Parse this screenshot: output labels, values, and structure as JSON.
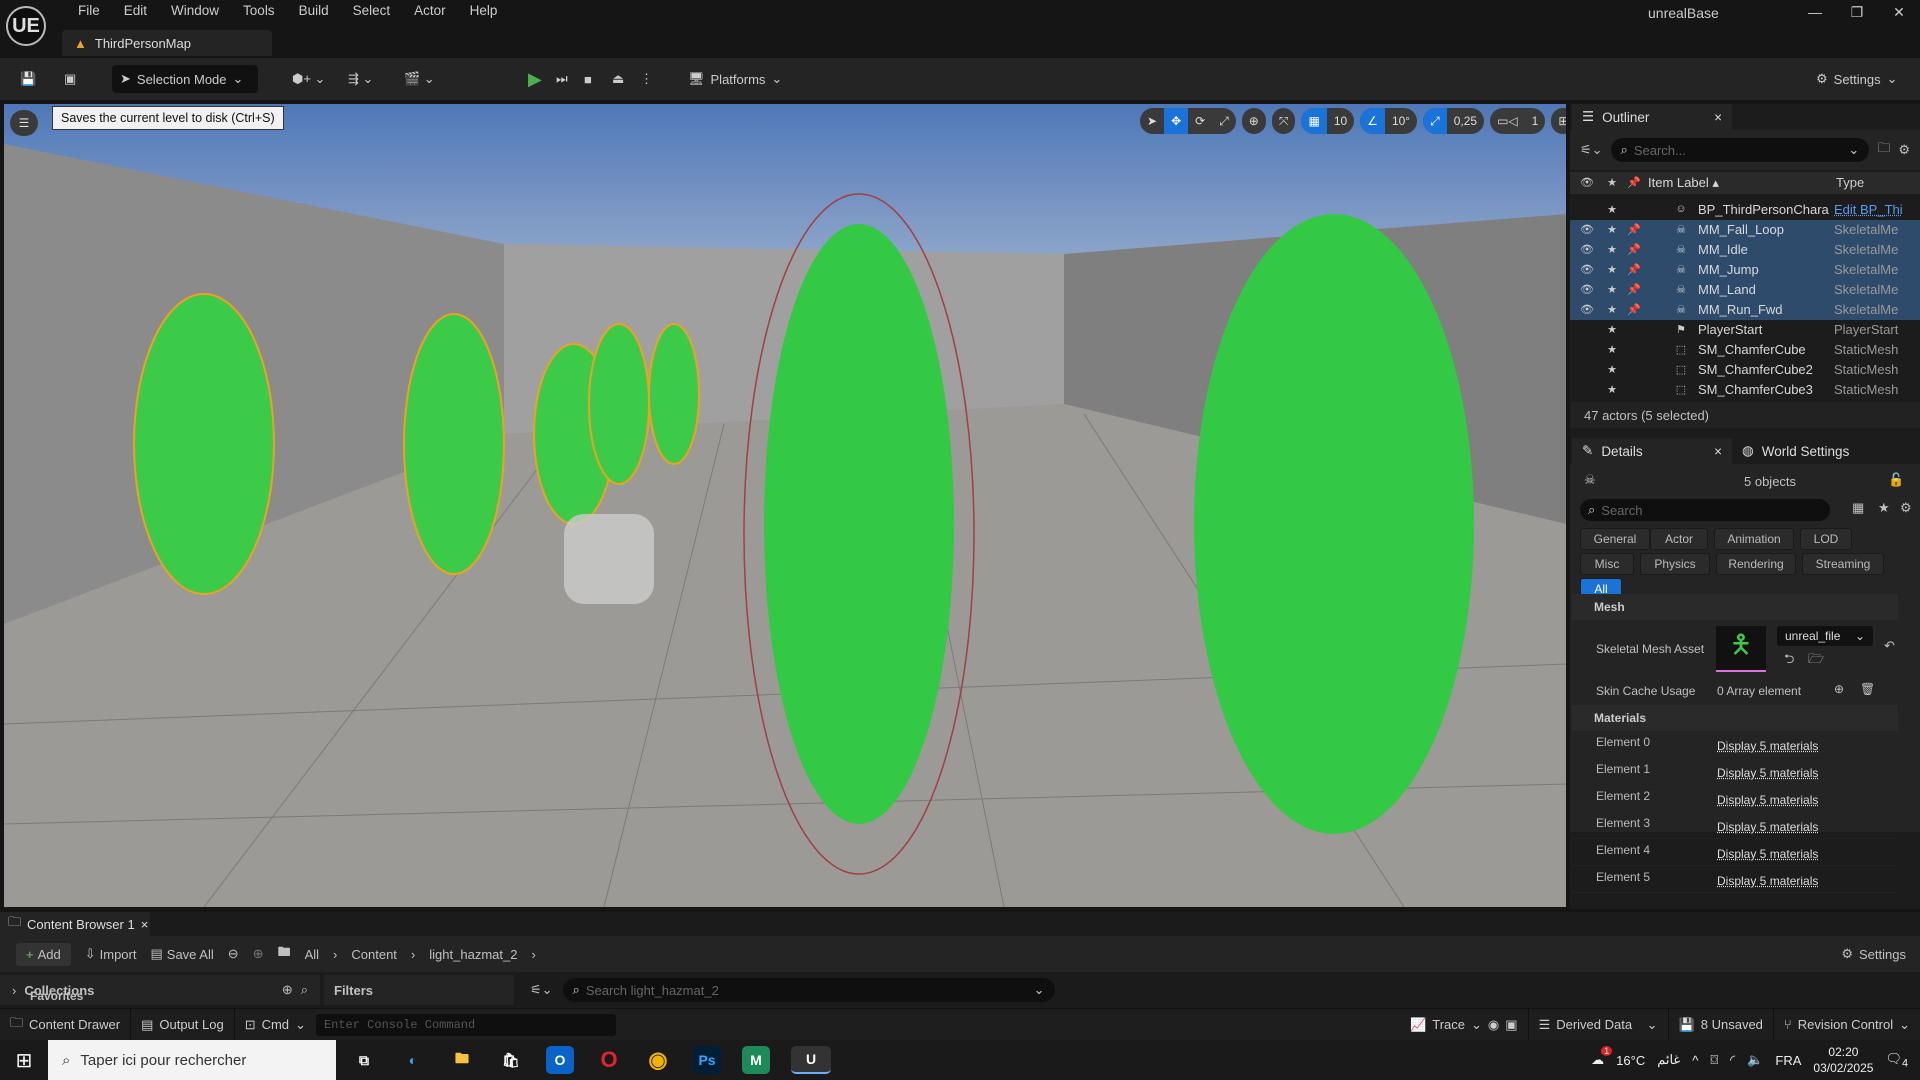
{
  "app": {
    "title": "unrealBase",
    "logo": "UE",
    "map_tab": "ThirdPersonMap"
  },
  "menu": [
    "File",
    "Edit",
    "Window",
    "Tools",
    "Build",
    "Select",
    "Actor",
    "Help"
  ],
  "toolbar": {
    "selection_mode": "Selection Mode",
    "platforms": "Platforms",
    "settings": "Settings",
    "tooltip": "Saves the current level to disk (Ctrl+S)"
  },
  "viewport": {
    "grid_snap": "10",
    "angle_snap": "10°",
    "scale_snap": "0,25",
    "camera_speed": "1"
  },
  "outliner": {
    "title": "Outliner",
    "search_placeholder": "Search...",
    "col_label": "Item Label",
    "col_type": "Type",
    "rows": [
      {
        "label": "BP_ThirdPersonChara",
        "type": "Edit BP_Thi",
        "selected": false,
        "icon": "character-icon"
      },
      {
        "label": "MM_Fall_Loop",
        "type": "SkeletalMe",
        "selected": true,
        "icon": "skeleton-icon"
      },
      {
        "label": "MM_Idle",
        "type": "SkeletalMe",
        "selected": true,
        "icon": "skeleton-icon"
      },
      {
        "label": "MM_Jump",
        "type": "SkeletalMe",
        "selected": true,
        "icon": "skeleton-icon"
      },
      {
        "label": "MM_Land",
        "type": "SkeletalMe",
        "selected": true,
        "icon": "skeleton-icon"
      },
      {
        "label": "MM_Run_Fwd",
        "type": "SkeletalMe",
        "selected": true,
        "icon": "skeleton-icon"
      },
      {
        "label": "PlayerStart",
        "type": "PlayerStart",
        "selected": false,
        "icon": "player-start-icon"
      },
      {
        "label": "SM_ChamferCube",
        "type": "StaticMesh",
        "selected": false,
        "icon": "static-mesh-icon"
      },
      {
        "label": "SM_ChamferCube2",
        "type": "StaticMesh",
        "selected": false,
        "icon": "static-mesh-icon"
      },
      {
        "label": "SM_ChamferCube3",
        "type": "StaticMesh",
        "selected": false,
        "icon": "static-mesh-icon"
      }
    ],
    "status": "47 actors (5 selected)"
  },
  "details": {
    "title": "Details",
    "world_settings": "World Settings",
    "objects": "5 objects",
    "search_placeholder": "Search",
    "filters": [
      "General",
      "Actor",
      "Animation",
      "LOD",
      "Misc",
      "Physics",
      "Rendering",
      "Streaming",
      "All"
    ],
    "mesh_section": "Mesh",
    "skeletal_mesh_label": "Skeletal Mesh Asset",
    "skeletal_mesh_value": "unreal_file",
    "skin_cache_label": "Skin Cache Usage",
    "skin_cache_value": "0 Array element",
    "materials_section": "Materials",
    "elements": [
      {
        "k": "Element 0",
        "v": "Display 5 materials"
      },
      {
        "k": "Element 1",
        "v": "Display 5 materials"
      },
      {
        "k": "Element 2",
        "v": "Display 5 materials"
      },
      {
        "k": "Element 3",
        "v": "Display 5 materials"
      },
      {
        "k": "Element 4",
        "v": "Display 5 materials"
      },
      {
        "k": "Element 5",
        "v": "Display 5 materials"
      }
    ]
  },
  "content_browser": {
    "tab": "Content Browser 1",
    "add": "Add",
    "import": "Import",
    "save_all": "Save All",
    "path": [
      "All",
      "Content",
      "light_hazmat_2"
    ],
    "settings": "Settings",
    "collections": "Collections",
    "favorites": "Favorites",
    "filters": "Filters",
    "search_placeholder": "Search light_hazmat_2"
  },
  "statusbar": {
    "content_drawer": "Content Drawer",
    "output_log": "Output Log",
    "cmd": "Cmd",
    "console_placeholder": "Enter Console Command",
    "trace": "Trace",
    "derived_data": "Derived Data",
    "unsaved": "8 Unsaved",
    "revision_control": "Revision Control"
  },
  "taskbar": {
    "search_placeholder": "Taper ici pour rechercher",
    "weather": "16°C",
    "weather_desc": "غائم",
    "weather_badge": "1",
    "lang": "FRA",
    "time": "02:20",
    "date": "03/02/2025",
    "notifications": "4"
  },
  "colors": {
    "accent": "#1a73d9",
    "selection": "#2f4b6c",
    "play": "#4caf50",
    "hazmat": "#3ccb48"
  }
}
